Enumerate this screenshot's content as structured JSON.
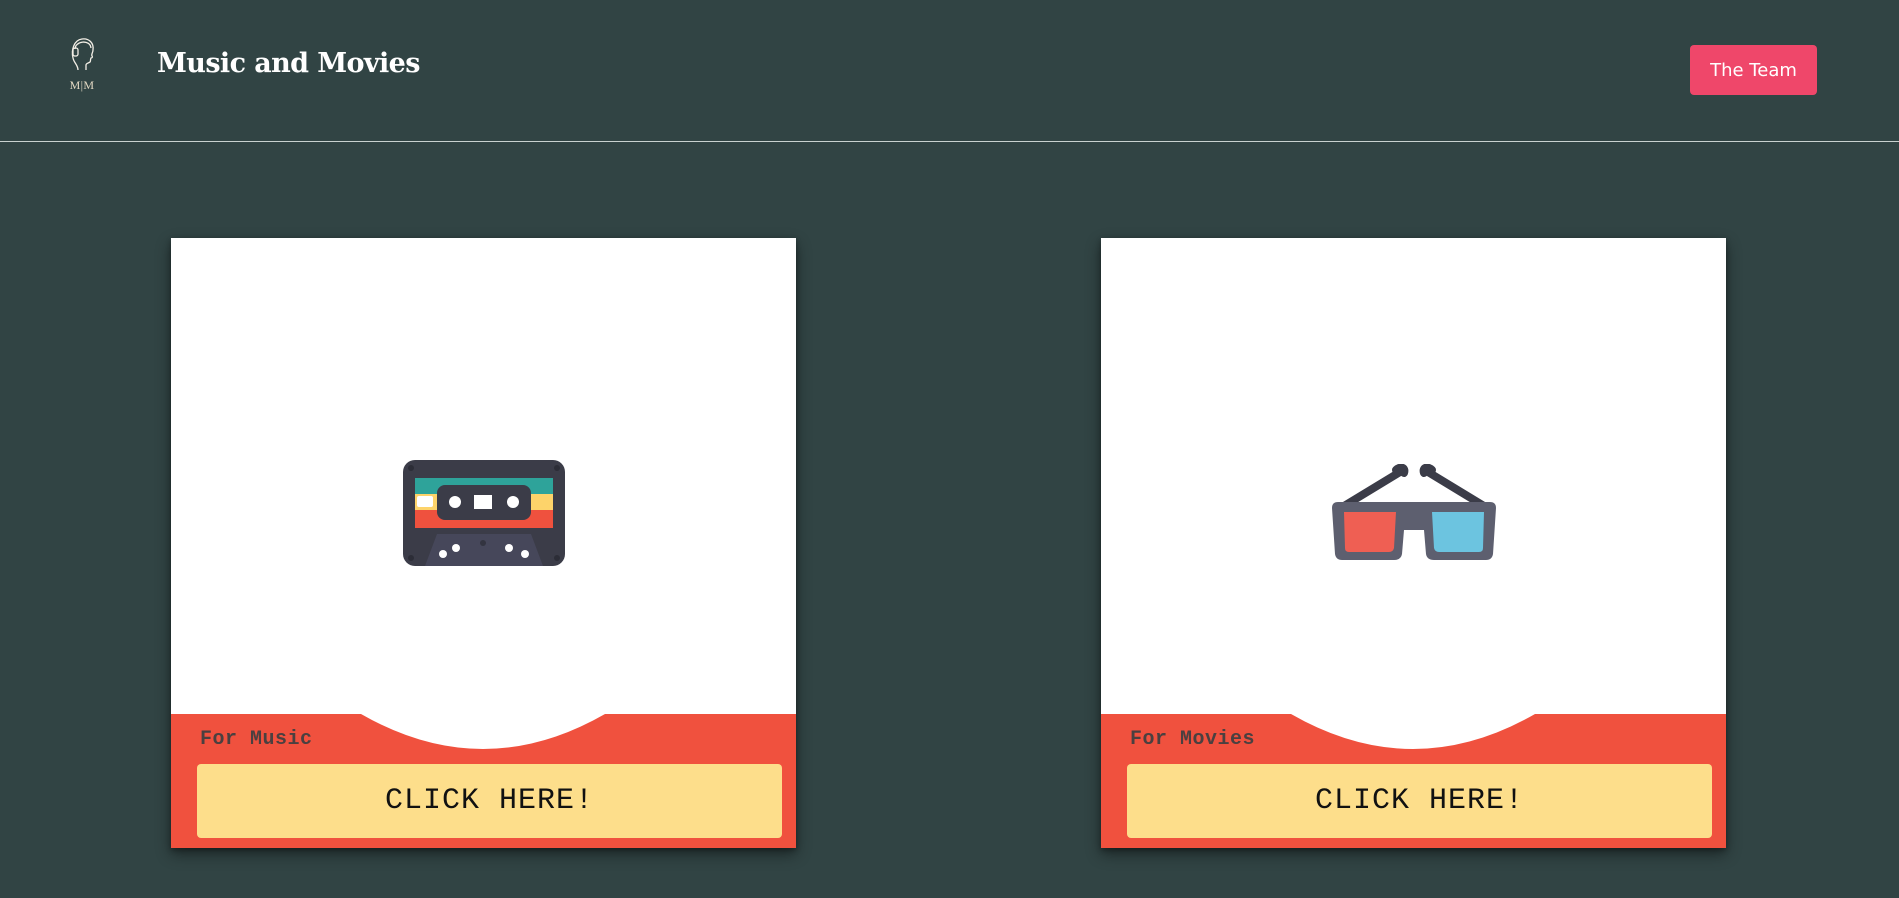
{
  "header": {
    "logo_text": "M|M",
    "title": "Music and Movies",
    "team_button_label": "The Team"
  },
  "cards": [
    {
      "icon": "cassette-tape-icon",
      "label": "For Music",
      "button_label": "CLICK HERE!"
    },
    {
      "icon": "3d-glasses-icon",
      "label": "For Movies",
      "button_label": "CLICK HERE!"
    }
  ],
  "colors": {
    "background": "#314444",
    "accent_button": "#ef476a",
    "card_footer": "#f0513e",
    "cta_button": "#fdde8b",
    "card_background": "#ffffff"
  }
}
